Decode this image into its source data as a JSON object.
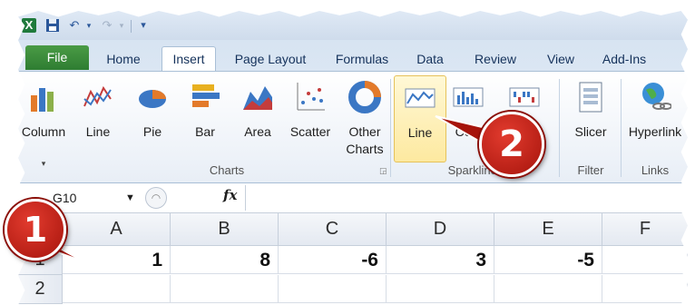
{
  "qat": {
    "customize_caret": "▾"
  },
  "tabs": [
    "File",
    "Home",
    "Insert",
    "Page Layout",
    "Formulas",
    "Data",
    "Review",
    "View",
    "Add-Ins"
  ],
  "ribbon": {
    "charts": {
      "column": "Column",
      "line": "Line",
      "pie": "Pie",
      "bar": "Bar",
      "area": "Area",
      "scatter": "Scatter",
      "other_1": "Other",
      "other_2": "Charts",
      "group": "Charts"
    },
    "sparklines": {
      "line": "Line",
      "column": "Colu",
      "winloss": "oss",
      "group": "Sparklines"
    },
    "filter": {
      "slicer": "Slicer",
      "group": "Filter"
    },
    "links": {
      "hyperlink": "Hyperlink",
      "group": "Links"
    }
  },
  "formula_bar": {
    "name_box": "G10",
    "fx": "fx"
  },
  "grid": {
    "columns": [
      "A",
      "B",
      "C",
      "D",
      "E",
      "F"
    ],
    "rows": [
      {
        "label": "1",
        "cells": [
          "1",
          "8",
          "-6",
          "3",
          "-5",
          ""
        ]
      },
      {
        "label": "2",
        "cells": [
          "",
          "",
          "",
          "",
          "",
          ""
        ]
      }
    ]
  },
  "callouts": {
    "one": "1",
    "two": "2"
  },
  "colors": {
    "file_tab": "#2e7d32",
    "callout": "#c0231a",
    "highlight": "#fde9a0"
  }
}
